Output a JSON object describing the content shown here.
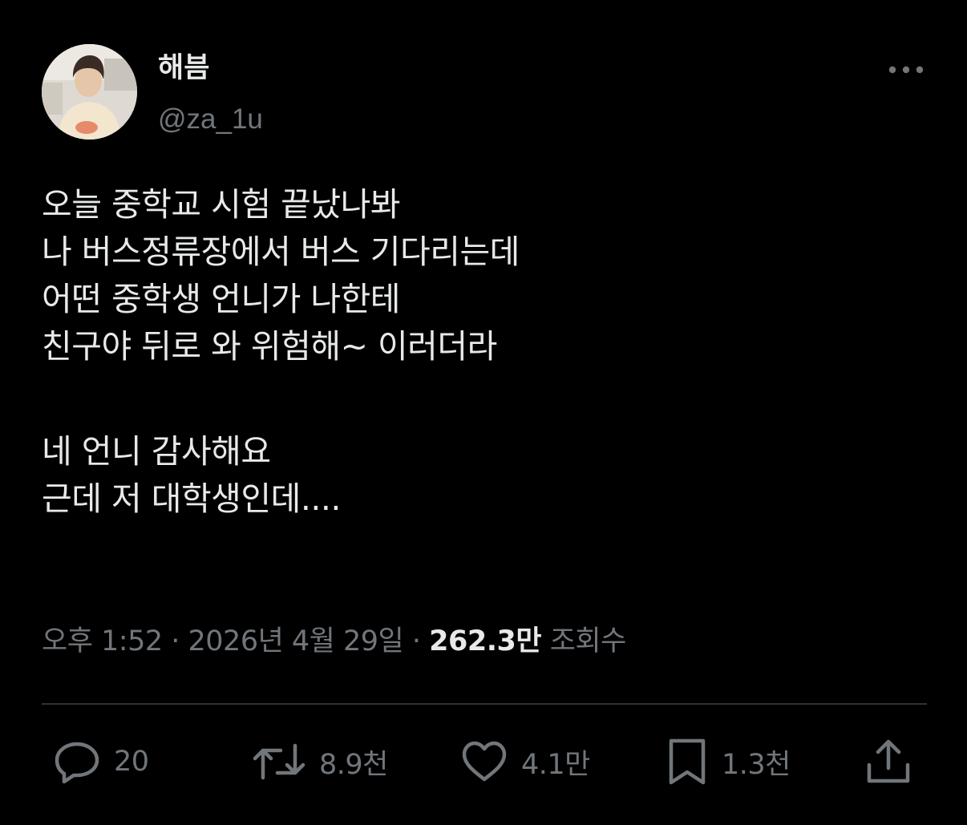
{
  "user": {
    "display_name": "해븜",
    "handle": "@za_1u"
  },
  "icons": {
    "more": "more-horizontal-icon",
    "reply": "reply-icon",
    "retweet": "retweet-icon",
    "like": "heart-icon",
    "bookmark": "bookmark-icon",
    "share": "share-icon"
  },
  "tweet": {
    "lines": [
      "오늘 중학교 시험 끝났나봐",
      "나 버스정류장에서 버스 기다리는데",
      "어떤 중학생 언니가 나한테",
      "친구야 뒤로 와 위험해~ 이러더라",
      "네 언니 감사해요",
      "근데 저 대학생인데...."
    ]
  },
  "meta": {
    "time": "오후 1:52",
    "separator": " · ",
    "date": "2026년 4월 29일",
    "views_count": "262.3만",
    "views_label": " 조회수"
  },
  "actions": {
    "reply_count": "20",
    "retweet_count": "8.9천",
    "like_count": "4.1만",
    "bookmark_count": "1.3천"
  },
  "colors": {
    "background": "#000000",
    "primary_text": "#e7e9ea",
    "secondary_text": "#71767b",
    "divider": "#2f3336"
  }
}
